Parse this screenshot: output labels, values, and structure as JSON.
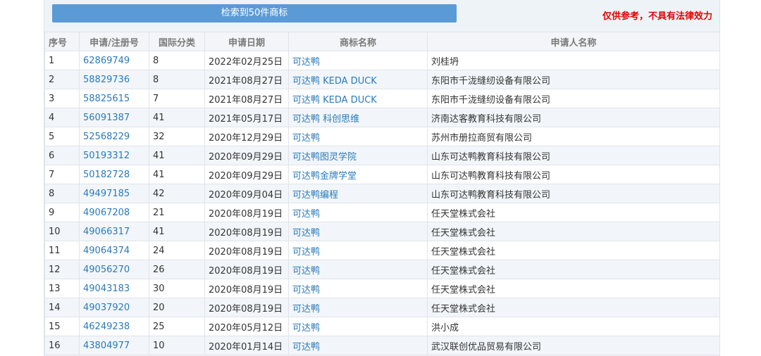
{
  "header": {
    "search_result": "检索到50件商标",
    "disclaimer": "仅供参考，不具有法律效力"
  },
  "table": {
    "columns": [
      "序号",
      "申请/注册号",
      "国际分类",
      "申请日期",
      "商标名称",
      "申请人名称"
    ],
    "rows": [
      [
        "1",
        "62869749",
        "8",
        "2022年02月25日",
        "可达鸭",
        "刘桂坍"
      ],
      [
        "2",
        "58829736",
        "8",
        "2021年08月27日",
        "可达鸭 KEDA DUCK",
        "东阳市千泷缝纫设备有限公司"
      ],
      [
        "3",
        "58825615",
        "7",
        "2021年08月27日",
        "可达鸭 KEDA DUCK",
        "东阳市千泷缝纫设备有限公司"
      ],
      [
        "4",
        "56091387",
        "41",
        "2021年05月17日",
        "可达鸭 科创思维",
        "济南达客教育科技有限公司"
      ],
      [
        "5",
        "52568229",
        "32",
        "2020年12月29日",
        "可达鸭",
        "苏州市册拉商贸有限公司"
      ],
      [
        "6",
        "50193312",
        "41",
        "2020年09月29日",
        "可达鸭图灵学院",
        "山东可达鸭教育科技有限公司"
      ],
      [
        "7",
        "50182728",
        "41",
        "2020年09月29日",
        "可达鸭金牌学堂",
        "山东可达鸭教育科技有限公司"
      ],
      [
        "8",
        "49497185",
        "42",
        "2020年09月04日",
        "可达鸭编程",
        "山东可达鸭教育科技有限公司"
      ],
      [
        "9",
        "49067208",
        "21",
        "2020年08月19日",
        "可达鸭",
        "任天堂株式会社"
      ],
      [
        "10",
        "49066317",
        "41",
        "2020年08月19日",
        "可达鸭",
        "任天堂株式会社"
      ],
      [
        "11",
        "49064374",
        "24",
        "2020年08月19日",
        "可达鸭",
        "任天堂株式会社"
      ],
      [
        "12",
        "49056270",
        "26",
        "2020年08月19日",
        "可达鸭",
        "任天堂株式会社"
      ],
      [
        "13",
        "49043183",
        "30",
        "2020年08月19日",
        "可达鸭",
        "任天堂株式会社"
      ],
      [
        "14",
        "49037920",
        "20",
        "2020年08月19日",
        "可达鸭",
        "任天堂株式会社"
      ],
      [
        "15",
        "46249238",
        "25",
        "2020年05月12日",
        "可达鸭",
        "洪小成"
      ],
      [
        "16",
        "43804977",
        "10",
        "2020年01月14日",
        "可达鸭",
        "武汉联创优品贸易有限公司"
      ]
    ]
  }
}
